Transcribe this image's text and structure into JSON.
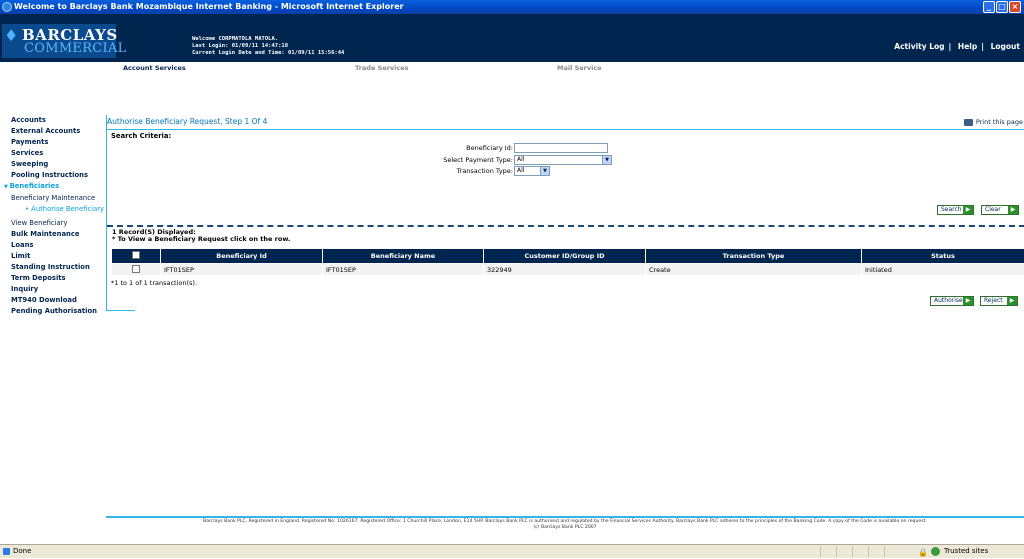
{
  "window": {
    "title": "Welcome to Barclays Bank Mozambique Internet Banking - Microsoft Internet Explorer"
  },
  "header": {
    "logo_line1": "BARCLAYS",
    "logo_line2": "COMMERCIAL",
    "welcome": "Welcome CORPMATOLA MATOLA.",
    "last_login": "Last Login: 01/09/11 14:47:18",
    "current_login": "Current Login Date and Time: 01/09/11 15:56:44",
    "links": [
      "Activity Log",
      "Help",
      "Logout"
    ],
    "separator": "|"
  },
  "tabs": [
    "Account Services",
    "Trade Services",
    "Mail Service"
  ],
  "nav": {
    "accounts": "Accounts",
    "external_accounts": "External Accounts",
    "payments": "Payments",
    "services": "Services",
    "sweeping": "Sweeping",
    "pooling": "Pooling Instructions",
    "beneficiaries": "Beneficiaries",
    "beneficiary_maintenance": "Beneficiary Maintenance",
    "authorise_beneficiary": "Authorise Beneficiary",
    "view_beneficiary": "View Beneficiary",
    "bulk_maintenance": "Bulk Maintenance",
    "loans": "Loans",
    "limit": "Limit",
    "standing_instruction": "Standing Instruction",
    "term_deposits": "Term Deposits",
    "inquiry": "Inquiry",
    "mt940": "MT940 Download",
    "pending": "Pending Authorisation"
  },
  "page": {
    "title": "Authorise Beneficiary Request, Step 1 Of 4",
    "print": "Print this page"
  },
  "search": {
    "heading": "Search Criteria:",
    "beneficiary_id_label": "Beneficiary Id:",
    "beneficiary_id_value": "",
    "payment_type_label": "Select Payment Type:",
    "payment_type_value": "All",
    "transaction_type_label": "Transaction Type:",
    "transaction_type_value": "All",
    "search_button": "Search",
    "clear_button": "Clear"
  },
  "results": {
    "records": "1 Record(S) Displayed:",
    "hint": "* To View a Beneficiary Request click on the row.",
    "columns": [
      "Beneficiary Id",
      "Beneficiary Name",
      "Customer ID/Group ID",
      "Transaction Type",
      "Status"
    ],
    "rows": [
      {
        "beneficiary_id": "IFT01SEP",
        "beneficiary_name": "IFT01SEP",
        "customer_id": "322949",
        "transaction_type": "Create",
        "status": "Initiated"
      }
    ],
    "summary": "*1 to 1 of 1 transaction(s).",
    "authorise_button": "Authorise",
    "reject_button": "Reject"
  },
  "footer": {
    "line1": "Barclays Bank PLC. Registered in England. Registered No: 1026167. Registered Office: 1 Churchill Place, London, E14 5HP. Barclays Bank PLC is authorised and regulated by the Financial Services Authority. Barclays Bank PLC adheres to the principles of the Banking Code. A copy of the Code is available on request.",
    "line2": "(c) Barclays Bank PLC 2007"
  },
  "statusbar": {
    "left": "Done",
    "zone": "Trusted sites"
  }
}
